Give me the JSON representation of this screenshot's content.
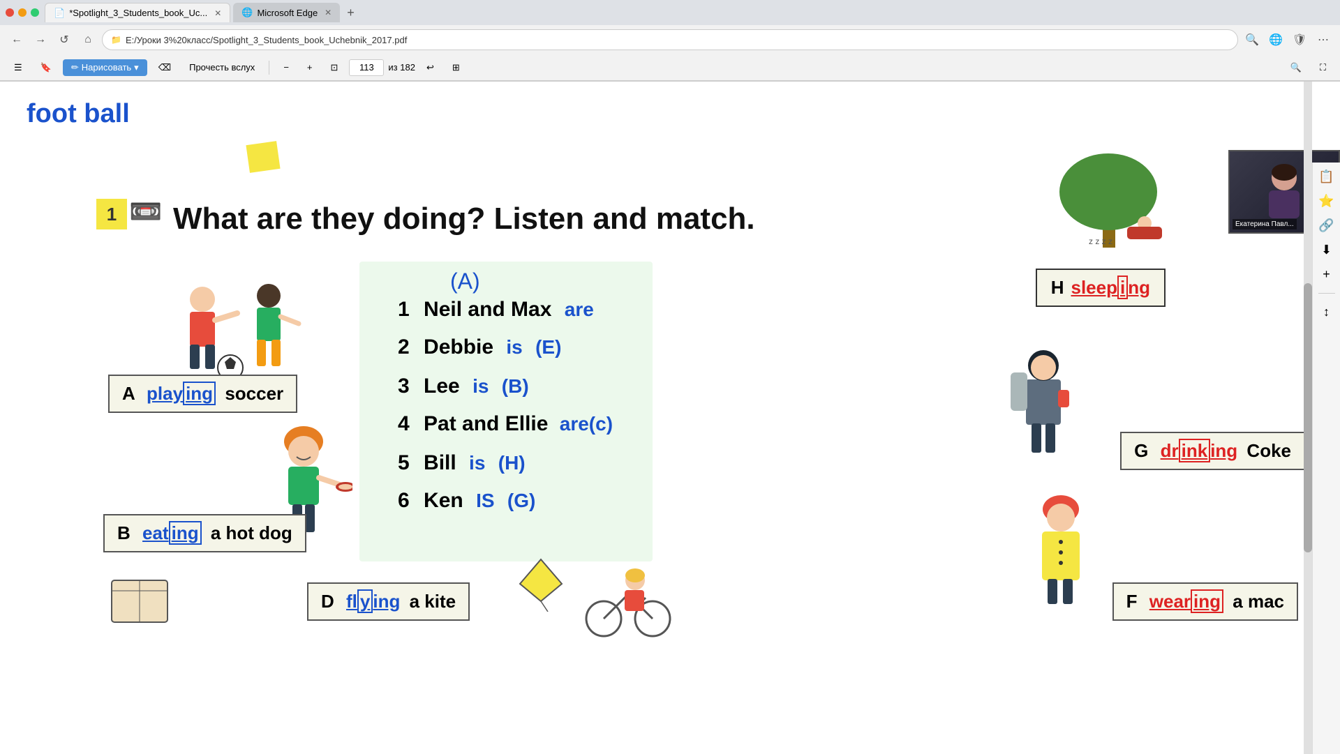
{
  "browser": {
    "tabs": [
      {
        "id": "tab1",
        "label": "*Spotlight_3_Students_book_Uc...",
        "active": true,
        "icon": "📄"
      },
      {
        "id": "tab2",
        "label": "Microsoft Edge",
        "active": false,
        "icon": "🌐"
      }
    ],
    "address": "E:/Уроки 3%20класс/Spotlight_3_Students_book_Uchebnik_2017.pdf",
    "nav": {
      "back": "←",
      "forward": "→",
      "refresh": "↺",
      "home": "🏠"
    }
  },
  "toolbar": {
    "hamburger": "☰",
    "draw_btn": "Нарисовать",
    "read_btn": "Прочесть вслух",
    "page_current": "113",
    "page_total": "из 182",
    "zoom_minus": "−",
    "zoom_plus": "+",
    "fit": "⊡"
  },
  "page": {
    "handwritten_top": "foot ball",
    "exercise_number": "1",
    "exercise_title": "What are they doing? Listen and match.",
    "label_a": "A  playing soccer",
    "label_b": "B  eating a hot dog",
    "label_d": "D  flying a kite",
    "label_f": "F  wearing a mac",
    "label_g": "G  drinking Coke",
    "label_h": "H  sleeping",
    "items": [
      {
        "num": "1",
        "subject": "Neil and Max",
        "answer": "are",
        "letter": "(A)"
      },
      {
        "num": "2",
        "subject": "Debbie",
        "answer": "is",
        "letter": "(E)"
      },
      {
        "num": "3",
        "subject": "Lee",
        "answer": "is",
        "letter": "(B)"
      },
      {
        "num": "4",
        "subject": "Pat and Ellie",
        "answer": "are",
        "letter": "(c)"
      },
      {
        "num": "5",
        "subject": "Bill",
        "answer": "is",
        "letter": "(H)"
      },
      {
        "num": "6",
        "subject": "Ken",
        "answer": "is",
        "letter": "(G)"
      }
    ]
  },
  "webcam": {
    "person_name": "Екатерина Павл..."
  }
}
